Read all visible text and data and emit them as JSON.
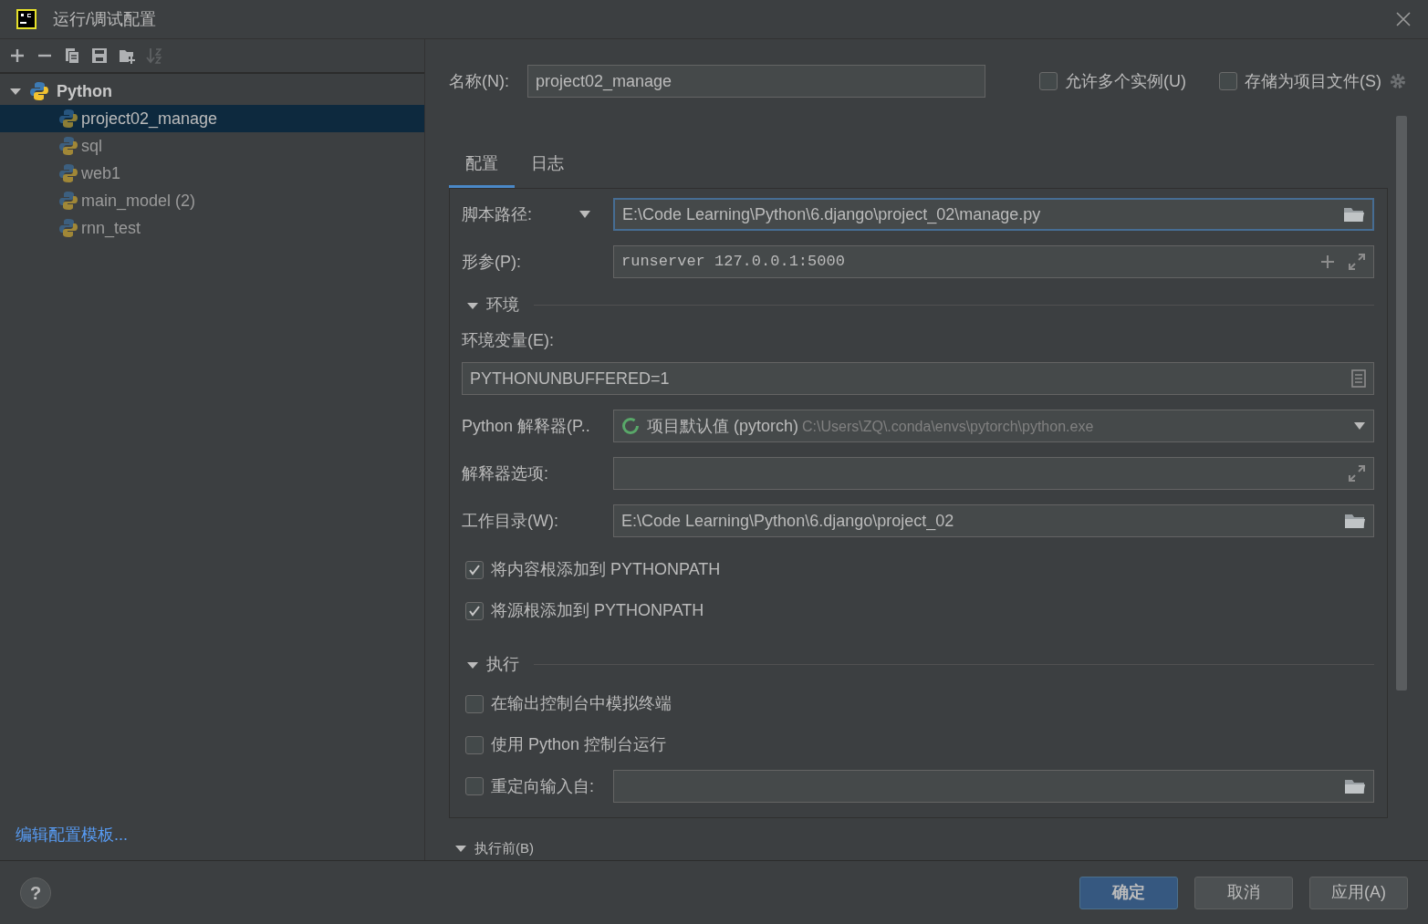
{
  "window": {
    "title": "运行/调试配置"
  },
  "toolbar": [
    {
      "kind": "add",
      "disabled": false
    },
    {
      "kind": "remove",
      "disabled": false
    },
    {
      "kind": "copy",
      "disabled": false
    },
    {
      "kind": "save",
      "disabled": false
    },
    {
      "kind": "folder",
      "disabled": false
    },
    {
      "kind": "sort",
      "disabled": true
    }
  ],
  "tree": {
    "label": "Python",
    "expanded": true,
    "children": [
      {
        "label": "project02_manage",
        "selected": true
      },
      {
        "label": "sql",
        "selected": false
      },
      {
        "label": "web1",
        "selected": false
      },
      {
        "label": "main_model (2)",
        "selected": false
      },
      {
        "label": "rnn_test",
        "selected": false
      }
    ]
  },
  "edit_templates_link": "编辑配置模板...",
  "name": {
    "label": "名称(N):",
    "value": "project02_manage"
  },
  "options": [
    {
      "label": "允许多个实例(U)",
      "checked": false
    },
    {
      "label": "存储为项目文件(S)",
      "checked": false
    }
  ],
  "tabs": [
    {
      "label": "配置",
      "selected": true
    },
    {
      "label": "日志",
      "selected": false
    }
  ],
  "script_path": {
    "label": "脚本路径:",
    "value": "E:\\Code Learning\\Python\\6.django\\project_02\\manage.py"
  },
  "parameters": {
    "label": "形参(P):",
    "value": "runserver 127.0.0.1:5000"
  },
  "environment": {
    "title": "环境",
    "expanded": true,
    "env_label": "环境变量(E):",
    "env_value": "PYTHONUNBUFFERED=1",
    "interpreter": {
      "label": "Python 解释器(P..",
      "name": "项目默认值 (pytorch)",
      "path": "C:\\Users\\ZQ\\.conda\\envs\\pytorch\\python.exe"
    },
    "interpreter_options": {
      "label": "解释器选项:"
    },
    "working_dir": {
      "label": "工作目录(W):",
      "value": "E:\\Code Learning\\Python\\6.django\\project_02"
    },
    "checks": [
      {
        "label": "将内容根添加到 PYTHONPATH",
        "checked": true
      },
      {
        "label": "将源根添加到 PYTHONPATH",
        "checked": true
      }
    ]
  },
  "execution": {
    "title": "执行",
    "expanded": true,
    "checks": [
      {
        "kind": "check",
        "label": "在输出控制台中模拟终端",
        "checked": false
      },
      {
        "kind": "check",
        "label": "使用 Python 控制台运行",
        "checked": false
      },
      {
        "kind": "check_field",
        "label": "重定向输入自:",
        "checked": false
      }
    ]
  },
  "before_launch": {
    "title": "执行前(B)",
    "expanded": true
  },
  "help_button": "?",
  "buttons": [
    {
      "kind": "primary",
      "label": "确定"
    },
    {
      "kind": "plain",
      "label": "取消"
    },
    {
      "kind": "plain",
      "label": "应用(A)"
    }
  ]
}
